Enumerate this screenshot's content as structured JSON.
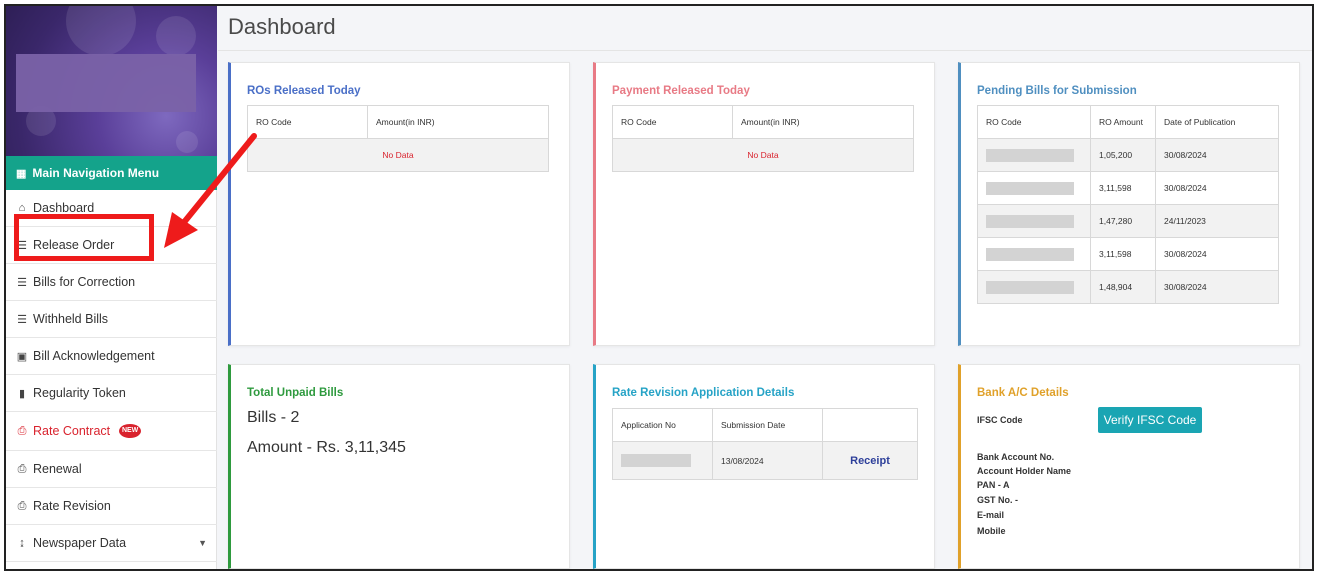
{
  "page": {
    "title": "Dashboard"
  },
  "sidebar": {
    "nav_header": "Main Navigation Menu",
    "items": [
      {
        "label": "Dashboard",
        "icon": "home-icon"
      },
      {
        "label": "Release Order",
        "icon": "list-icon"
      },
      {
        "label": "Bills for Correction",
        "icon": "list-icon"
      },
      {
        "label": "Withheld Bills",
        "icon": "list-icon"
      },
      {
        "label": "Bill Acknowledgement",
        "icon": "card-icon"
      },
      {
        "label": "Regularity Token",
        "icon": "file-icon"
      },
      {
        "label": "Rate Contract",
        "icon": "print-icon",
        "badge": "NEW"
      },
      {
        "label": "Renewal",
        "icon": "print-icon"
      },
      {
        "label": "Rate Revision",
        "icon": "print-icon"
      },
      {
        "label": "Newspaper Data",
        "icon": "sort-icon"
      }
    ]
  },
  "cards": {
    "ros_today": {
      "title": "ROs Released Today",
      "headers": [
        "RO Code",
        "Amount(in INR)"
      ],
      "empty": "No Data",
      "color": "#4a6fc7"
    },
    "payment_today": {
      "title": "Payment Released Today",
      "headers": [
        "RO Code",
        "Amount(in INR)"
      ],
      "empty": "No Data",
      "color": "#e87a85"
    },
    "pending_bills": {
      "title": "Pending Bills for Submission",
      "headers": [
        "RO Code",
        "RO Amount",
        "Date of Publication"
      ],
      "rows": [
        {
          "amount": "1,05,200",
          "date": "30/08/2024"
        },
        {
          "amount": "3,11,598",
          "date": "30/08/2024"
        },
        {
          "amount": "1,47,280",
          "date": "24/11/2023"
        },
        {
          "amount": "3,11,598",
          "date": "30/08/2024"
        },
        {
          "amount": "1,48,904",
          "date": "30/08/2024"
        }
      ],
      "color": "#4f8fc0"
    },
    "unpaid": {
      "title": "Total Unpaid Bills",
      "bills": "Bills - 2",
      "amount": "Amount - Rs. 3,11,345",
      "color": "#2e9a3e"
    },
    "rate_revision": {
      "title": "Rate Revision Application Details",
      "headers": [
        "Application No",
        "Submission Date",
        ""
      ],
      "row": {
        "date": "13/08/2024",
        "receipt": "Receipt"
      },
      "color": "#26a3c6"
    },
    "bank": {
      "title": "Bank A/C Details",
      "ifsc_label": "IFSC Code",
      "verify_btn": "Verify IFSC Code",
      "account_label": "Bank Account No.",
      "holder_label": "Account Holder Name",
      "pan_label": "PAN - A",
      "gst_label": "GST No. -",
      "email_label": "E-mail",
      "mobile_label": "Mobile",
      "color": "#e0a12a"
    }
  }
}
